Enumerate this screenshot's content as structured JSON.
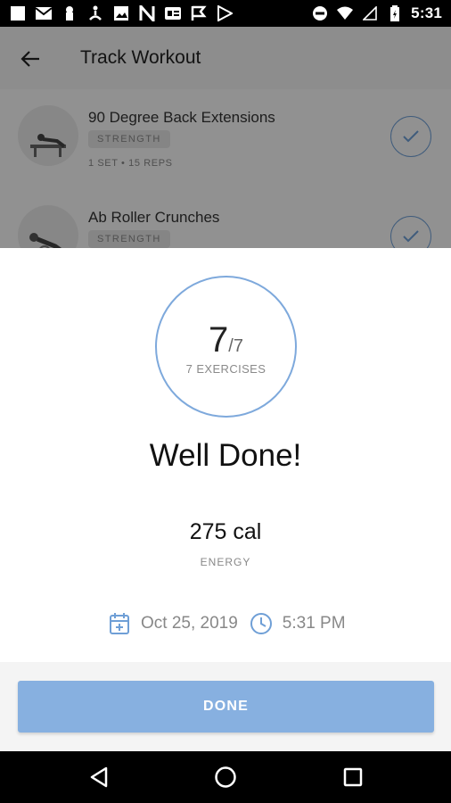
{
  "status_bar": {
    "time": "5:31",
    "icons": [
      "square-icon",
      "gmail-icon",
      "keyhole-icon",
      "yoga-icon",
      "image-icon",
      "n-icon",
      "id-card-icon",
      "flag-icon",
      "play-icon",
      "dnd-icon",
      "wifi-icon",
      "signal-icon",
      "battery-icon"
    ]
  },
  "app_bar": {
    "title": "Track Workout",
    "back_icon": "arrow-back-icon"
  },
  "exercises": [
    {
      "name": "90 Degree Back Extensions",
      "tag": "STRENGTH",
      "meta": "1 SET • 15 REPS",
      "completed": true
    },
    {
      "name": "Ab Roller Crunches",
      "tag": "STRENGTH",
      "meta": "",
      "completed": true
    }
  ],
  "summary": {
    "completed": "7",
    "total": "/7",
    "progress_label": "7 EXERCISES",
    "progress_fraction": 1,
    "headline": "Well Done!",
    "energy_value": "275 cal",
    "energy_label": "ENERGY",
    "date": "Oct 25, 2019",
    "time": "5:31 PM"
  },
  "footer": {
    "done_label": "DONE"
  },
  "nav_bar": {
    "icons": [
      "back-triangle-icon",
      "home-circle-icon",
      "recents-square-icon"
    ]
  },
  "colors": {
    "accent": "#7ea9dc",
    "button": "#87b0e0"
  }
}
